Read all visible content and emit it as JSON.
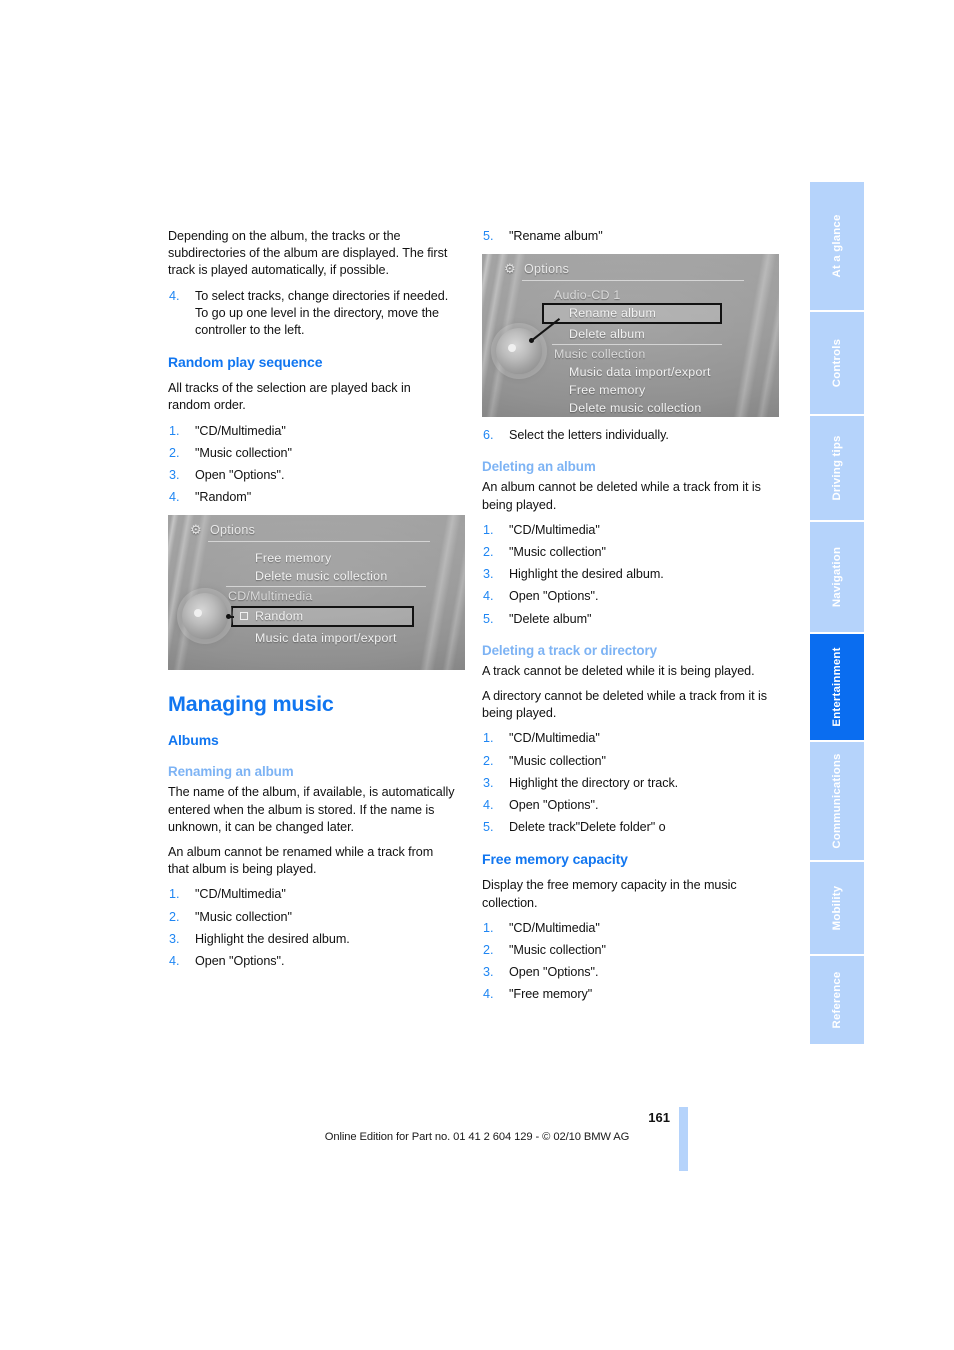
{
  "document": {
    "page_number": "161",
    "footer_note": "Online Edition for Part no. 01 41 2 604 129 - © 02/10 BMW AG"
  },
  "sidebar": {
    "tabs": [
      {
        "label": "At a glance",
        "active": false
      },
      {
        "label": "Controls",
        "active": false
      },
      {
        "label": "Driving tips",
        "active": false
      },
      {
        "label": "Navigation",
        "active": false
      },
      {
        "label": "Entertainment",
        "active": true
      },
      {
        "label": "Communications",
        "active": false
      },
      {
        "label": "Mobility",
        "active": false
      },
      {
        "label": "Reference",
        "active": false
      }
    ],
    "active_color": "#0a6df0",
    "inactive_color": "#b5d3fb"
  },
  "left_column": {
    "intro_paragraph": "Depending on the album, the tracks or the subdirectories of the album are displayed. The first track is played automatically, if possible.",
    "step_4": "To select tracks, change directories if needed. To go up one level in the directory, move the controller to the left.",
    "random_play": {
      "heading": "Random play sequence",
      "intro": "All tracks of the selection are played back in random order.",
      "steps": [
        "\"CD/Multimedia\"",
        "\"Music collection\"",
        "Open \"Options\".",
        "\"Random\""
      ]
    },
    "figure_random": {
      "title": "Options",
      "gear_icon": "gear-icon",
      "items": [
        "Free memory",
        "Delete music collection",
        "CD/Multimedia",
        "Random",
        "Music data import/export"
      ],
      "highlighted_item": "Random",
      "checkbox_item": "Random"
    },
    "managing_music": {
      "heading": "Managing music",
      "albums_heading": "Albums",
      "renaming": {
        "heading": "Renaming an album",
        "paragraph_1": "The name of the album, if available, is automatically entered when the album is stored. If the name is unknown, it can be changed later.",
        "paragraph_2": "An album cannot be renamed while a track from that album is being played.",
        "steps": [
          "\"CD/Multimedia\"",
          "\"Music collection\"",
          "Highlight the desired album.",
          "Open \"Options\"."
        ]
      }
    }
  },
  "right_column": {
    "renaming_continued": {
      "step_5": "\"Rename album\"",
      "step_6": "Select the letters individually."
    },
    "figure_rename": {
      "title": "Options",
      "gear_icon": "gear-icon",
      "items": [
        "Audio-CD 1",
        "Rename album",
        "Delete album",
        "Music collection",
        "Music data import/export",
        "Free memory",
        "Delete music collection"
      ],
      "highlighted_item": "Rename album"
    },
    "deleting_album": {
      "heading": "Deleting an album",
      "intro": "An album cannot be deleted while a track from it is being played.",
      "steps": [
        "\"CD/Multimedia\"",
        "\"Music collection\"",
        "Highlight the desired album.",
        "Open \"Options\".",
        "\"Delete album\""
      ]
    },
    "deleting_track": {
      "heading": "Deleting a track or directory",
      "paragraph_1": "A track cannot be deleted while it is being played.",
      "paragraph_2": "A directory cannot be deleted while a track from it is being played.",
      "steps": [
        "\"CD/Multimedia\"",
        "\"Music collection\"",
        "Highlight the directory or track.",
        "Open \"Options\".",
        "Delete track\"Delete folder\" o"
      ]
    },
    "free_memory": {
      "heading": "Free memory capacity",
      "intro": "Display the free memory capacity in the music collection.",
      "steps": [
        "\"CD/Multimedia\"",
        "\"Music collection\"",
        "Open \"Options\".",
        "\"Free memory\""
      ]
    }
  }
}
